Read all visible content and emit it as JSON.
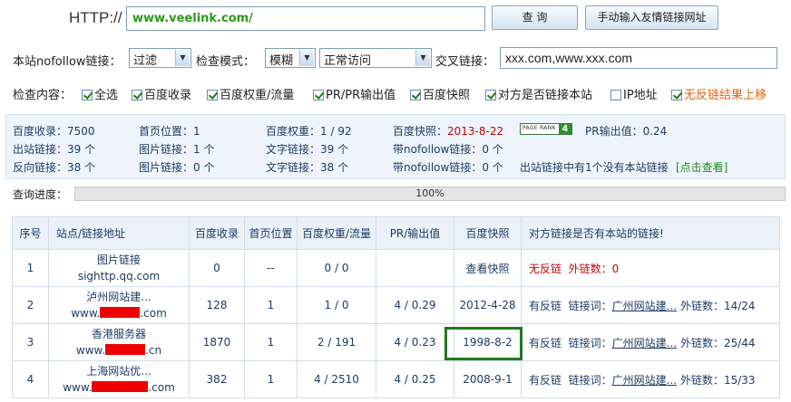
{
  "toolbar": {
    "http_label": "HTTP://",
    "url_value": "www.veelink.com/",
    "query_button": "查 询",
    "manual_button": "手动输入友情链接网址"
  },
  "options": {
    "nofollow_label": "本站nofollow链接：",
    "nofollow_value": "过滤",
    "mode_label": "检查模式：",
    "mode_value": "模糊",
    "access_value": "正常访问",
    "cross_label": "交叉链接：",
    "cross_value": "xxx.com,www.xxx.com"
  },
  "check": {
    "label": "检查内容：",
    "items": [
      {
        "label": "全选",
        "checked": true
      },
      {
        "label": "百度收录",
        "checked": true
      },
      {
        "label": "百度权重/流量",
        "checked": true
      },
      {
        "label": "PR/PR输出值",
        "checked": true
      },
      {
        "label": "百度快照",
        "checked": true
      },
      {
        "label": "对方是否链接本站",
        "checked": true
      },
      {
        "label": "IP地址",
        "checked": false
      },
      {
        "label": "无反链结果上移",
        "checked": true
      }
    ]
  },
  "stats": {
    "r1": {
      "baidu_index_l": "百度收录：",
      "baidu_index_v": "7500",
      "home_pos_l": "首页位置：",
      "home_pos_v": "1",
      "weight_l": "百度权重：",
      "weight_v": "1 / 92",
      "snapshot_l": "百度快照：",
      "snapshot_v": "2013-8-22",
      "pr_badge_text": "PAGE RANK",
      "pr_badge_num": "4",
      "pr_out_l": "PR输出值：",
      "pr_out_v": "0.24"
    },
    "r2": {
      "out_l": "出站链接：",
      "out_v": "39 个",
      "img_l": "图片链接：",
      "img_v": "1 个",
      "text_l": "文字链接：",
      "text_v": "39 个",
      "nf_l": "带nofollow链接：",
      "nf_v": "0 个"
    },
    "r3": {
      "back_l": "反向链接：",
      "back_v": "38 个",
      "img_l": "图片链接：",
      "img_v": "0 个",
      "text_l": "文字链接：",
      "text_v": "38 个",
      "nf_l": "带nofollow链接：",
      "nf_v": "0 个",
      "note": "出站链接中有1个没有本站链接",
      "view": "[点击查看]"
    }
  },
  "progress": {
    "label": "查询进度：",
    "value": "100%",
    "fraction": 1.0
  },
  "table": {
    "headers": [
      "序号",
      "站点/链接地址",
      "百度收录",
      "首页位置",
      "百度权重/流量",
      "PR/输出值",
      "百度快照",
      "对方链接是否有本站的链接!"
    ],
    "rows": [
      {
        "no": "1",
        "name": "图片链接",
        "url_pre": "sighttp.qq.com",
        "url_post": "",
        "index": "0",
        "pos": "--",
        "weight": "0 / 0",
        "pr": "",
        "snap": "查看快照",
        "result": "无反链",
        "extra": "外链数：0"
      },
      {
        "no": "2",
        "name": "泸州网站建...",
        "url_pre": "www.",
        "url_post": ".com",
        "index": "128",
        "pos": "1",
        "weight": "1 / 0",
        "pr": "4 / 0.29",
        "snap": "2012-4-28",
        "result": "有反链",
        "anchor_l": "链接词：",
        "anchor": "广州网站建...",
        "extra": "外链数：14/24"
      },
      {
        "no": "3",
        "name": "香港服务器",
        "url_pre": "www.",
        "url_post": ".cn",
        "index": "1870",
        "pos": "1",
        "weight": "2 / 191",
        "pr": "4 / 0.23",
        "snap": "1998-8-2",
        "result": "有反链",
        "anchor_l": "链接词：",
        "anchor": "广州网站建...",
        "extra": "外链数：25/44"
      },
      {
        "no": "4",
        "name": "上海网站优...",
        "url_pre": "www.",
        "url_post": ".com",
        "index": "382",
        "pos": "1",
        "weight": "4 / 2510",
        "pr": "4 / 0.25",
        "snap": "2008-9-1",
        "result": "有反链",
        "anchor_l": "链接词：",
        "anchor": "广州网站建...",
        "extra": "外链数：15/33"
      }
    ]
  }
}
